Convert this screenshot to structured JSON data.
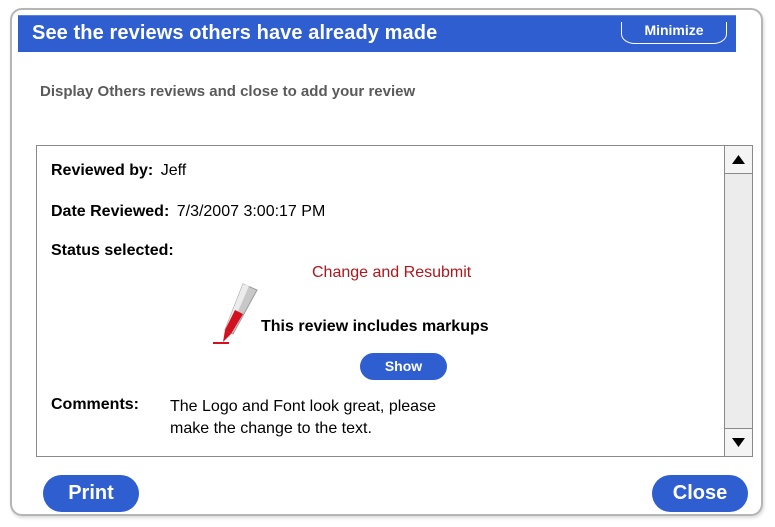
{
  "dialog": {
    "title": "See the reviews others have already made",
    "minimize_label": "Minimize",
    "subtitle": "Display Others reviews and close to add your review"
  },
  "review": {
    "reviewed_by_label": "Reviewed by:",
    "reviewed_by_value": "Jeff",
    "date_label": "Date Reviewed:",
    "date_value": "7/3/2007 3:00:17 PM",
    "status_label": "Status selected:",
    "status_value": "Change and Resubmit",
    "markup_text": "This review includes markups",
    "show_label": "Show",
    "comments_label": "Comments:",
    "comments_line1": "The Logo and Font look great, please",
    "comments_line2": "make the change to the text."
  },
  "footer": {
    "print_label": "Print",
    "close_label": "Close"
  },
  "colors": {
    "accent": "#2e5ed0",
    "status": "#b0161c",
    "pen": "#d4101e"
  },
  "icons": {
    "pen": "pen-markup-icon",
    "scroll_up": "arrow-up-icon",
    "scroll_down": "arrow-down-icon"
  }
}
